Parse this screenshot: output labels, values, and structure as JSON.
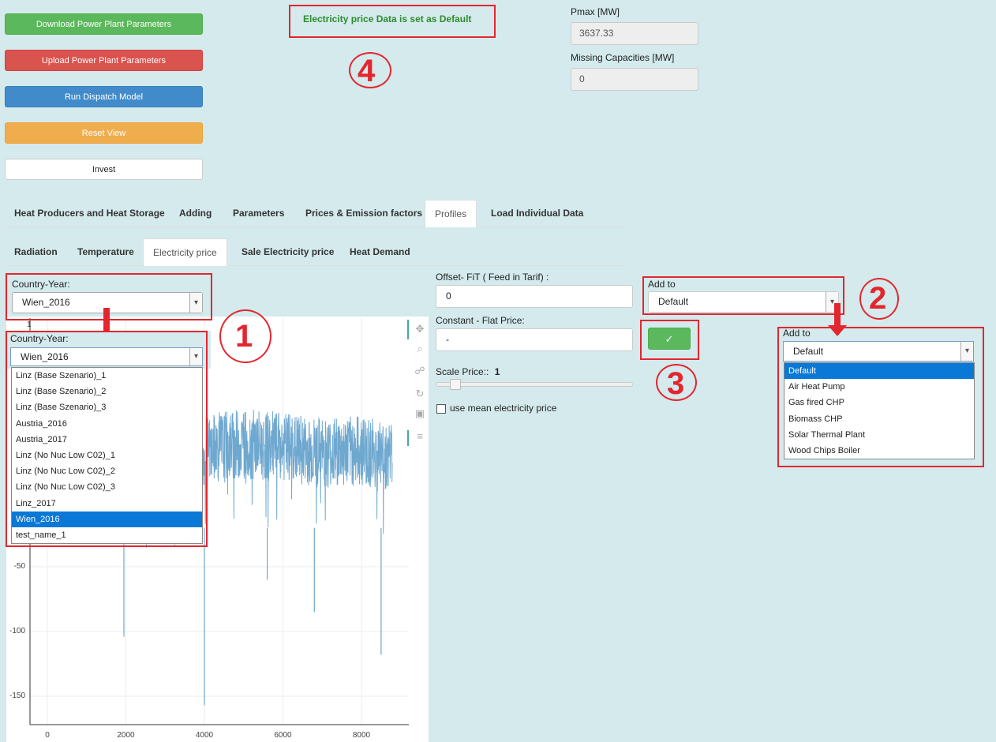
{
  "buttons": {
    "download": "Download Power Plant Parameters",
    "upload": "Upload Power Plant Parameters",
    "run": "Run Dispatch Model",
    "reset": "Reset View",
    "invest": "Invest"
  },
  "status": {
    "message": "Electricity price Data is set as Default"
  },
  "markers": {
    "m1": "1",
    "m2": "2",
    "m3": "3",
    "m4": "4"
  },
  "capacity": {
    "pmax_label": "Pmax [MW]",
    "pmax_value": "3637.33",
    "missing_label": "Missing Capacities [MW]",
    "missing_value": "0"
  },
  "main_tabs": [
    "Heat Producers and Heat Storage",
    "Adding",
    "Parameters",
    "Prices & Emission factors",
    "Profiles",
    "Load Individual Data"
  ],
  "sub_tabs": [
    "Radiation",
    "Temperature",
    "Electricity price",
    "Sale Electricity price",
    "Heat Demand"
  ],
  "country_year": {
    "label": "Country-Year:",
    "value": "Wien_2016",
    "options": [
      "Linz (Base Szenario)_1",
      "Linz (Base Szenario)_2",
      "Linz (Base Szenario)_3",
      "Austria_2016",
      "Austria_2017",
      "Linz (No Nuc Low C02)_1",
      "Linz (No Nuc Low C02)_2",
      "Linz (No Nuc Low C02)_3",
      "Linz_2017",
      "Wien_2016",
      "test_name_1"
    ],
    "selected_index": 9
  },
  "form": {
    "offset_label": "Offset- FiT ( Feed in Tarif) :",
    "offset_value": "0",
    "constant_label": "Constant - Flat Price:",
    "constant_value": "-",
    "scale_label": "Scale Price::",
    "scale_value": "1",
    "mean_label": "use mean electricity price",
    "confirm_symbol": "✓"
  },
  "add_to": {
    "label": "Add to",
    "value": "Default",
    "options": [
      "Default",
      "Air Heat Pump",
      "Gas fired CHP",
      "Biomass CHP",
      "Solar Thermal Plant",
      "Wood Chips Boiler"
    ],
    "selected_index": 0
  },
  "chart_data": {
    "type": "line",
    "title": "",
    "xlabel": "",
    "ylabel": "",
    "xlim": [
      -400,
      9200
    ],
    "ylim": [
      -165,
      12
    ],
    "x_ticks": [
      0,
      2000,
      4000,
      6000,
      8000
    ],
    "y_ticks": [
      -50,
      -100,
      -150
    ],
    "y_ticks_partial": [
      "1",
      "1"
    ],
    "series_color": "#6fa8cf",
    "points_approx": [
      [
        0,
        20
      ],
      [
        1000,
        25
      ],
      [
        2000,
        30
      ],
      [
        3000,
        35
      ],
      [
        4000,
        40
      ],
      [
        5000,
        45
      ],
      [
        6000,
        42
      ],
      [
        7000,
        38
      ],
      [
        8000,
        40
      ],
      [
        8784,
        35
      ]
    ],
    "notable_dips": [
      [
        1950,
        -104
      ],
      [
        4000,
        -157
      ],
      [
        5600,
        -60
      ],
      [
        6800,
        -85
      ],
      [
        8500,
        -118
      ]
    ]
  },
  "plot_tools": [
    "pan-icon",
    "zoom-icon",
    "wheel-zoom-icon",
    "reset-icon",
    "save-icon",
    "hover-icon"
  ]
}
